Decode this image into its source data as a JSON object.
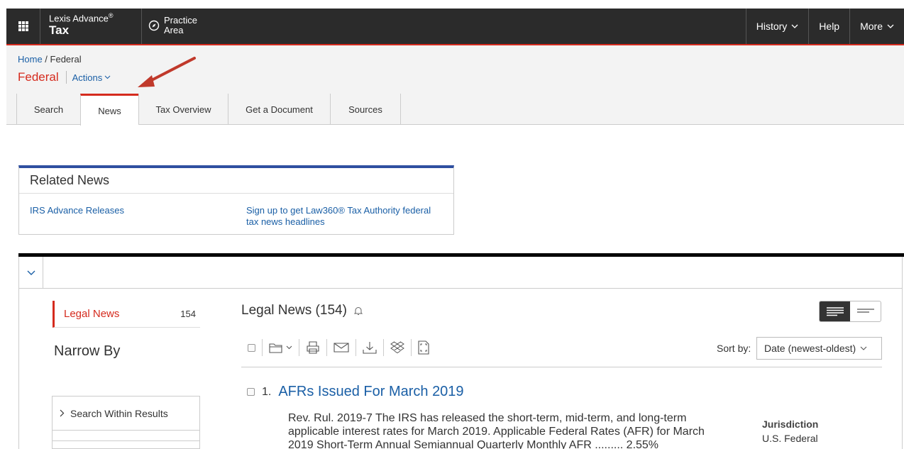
{
  "topbar": {
    "brand_line1": "Lexis Advance",
    "brand_reg": "®",
    "brand_line2": "Tax",
    "practice_line1": "Practice",
    "practice_line2": "Area",
    "nav": [
      {
        "label": "History",
        "dropdown": true
      },
      {
        "label": "Help",
        "dropdown": false
      },
      {
        "label": "More",
        "dropdown": true
      }
    ]
  },
  "breadcrumb": {
    "home": "Home",
    "separator": " / ",
    "current": "Federal"
  },
  "page_title": "Federal",
  "actions_label": "Actions",
  "tabs": [
    {
      "label": "Search",
      "active": false
    },
    {
      "label": "News",
      "active": true
    },
    {
      "label": "Tax Overview",
      "active": false
    },
    {
      "label": "Get a Document",
      "active": false
    },
    {
      "label": "Sources",
      "active": false
    }
  ],
  "related_news": {
    "title": "Related News",
    "links": [
      "IRS Advance Releases",
      "Sign up to get Law360® Tax Authority federal tax news headlines"
    ]
  },
  "sidebar": {
    "legal_news_label": "Legal News",
    "legal_news_count": "154",
    "narrow_by": "Narrow By",
    "search_within": "Search Within Results"
  },
  "results": {
    "title": "Legal News (154)",
    "sort_label": "Sort by:",
    "sort_value": "Date (newest-oldest)",
    "items": [
      {
        "number": "1.",
        "title": "AFRs Issued For March 2019",
        "snippet_line1": "Rev. Rul. 2019-7   The IRS has released the short-term, mid-term, and long-term",
        "snippet_line2": "applicable interest rates for March 2019. Applicable Federal Rates (AFR) for March",
        "snippet_line3": "2019 Short-Term Annual Semiannual Quarterly Monthly AFR ......... 2.55%",
        "jurisdiction_label": "Jurisdiction",
        "jurisdiction_value": "U.S. Federal"
      }
    ]
  },
  "colors": {
    "accent_red": "#d52b1e",
    "link_blue": "#1a5fa6",
    "topbar": "#2b2b2b",
    "related_border": "#2f4fa0"
  }
}
